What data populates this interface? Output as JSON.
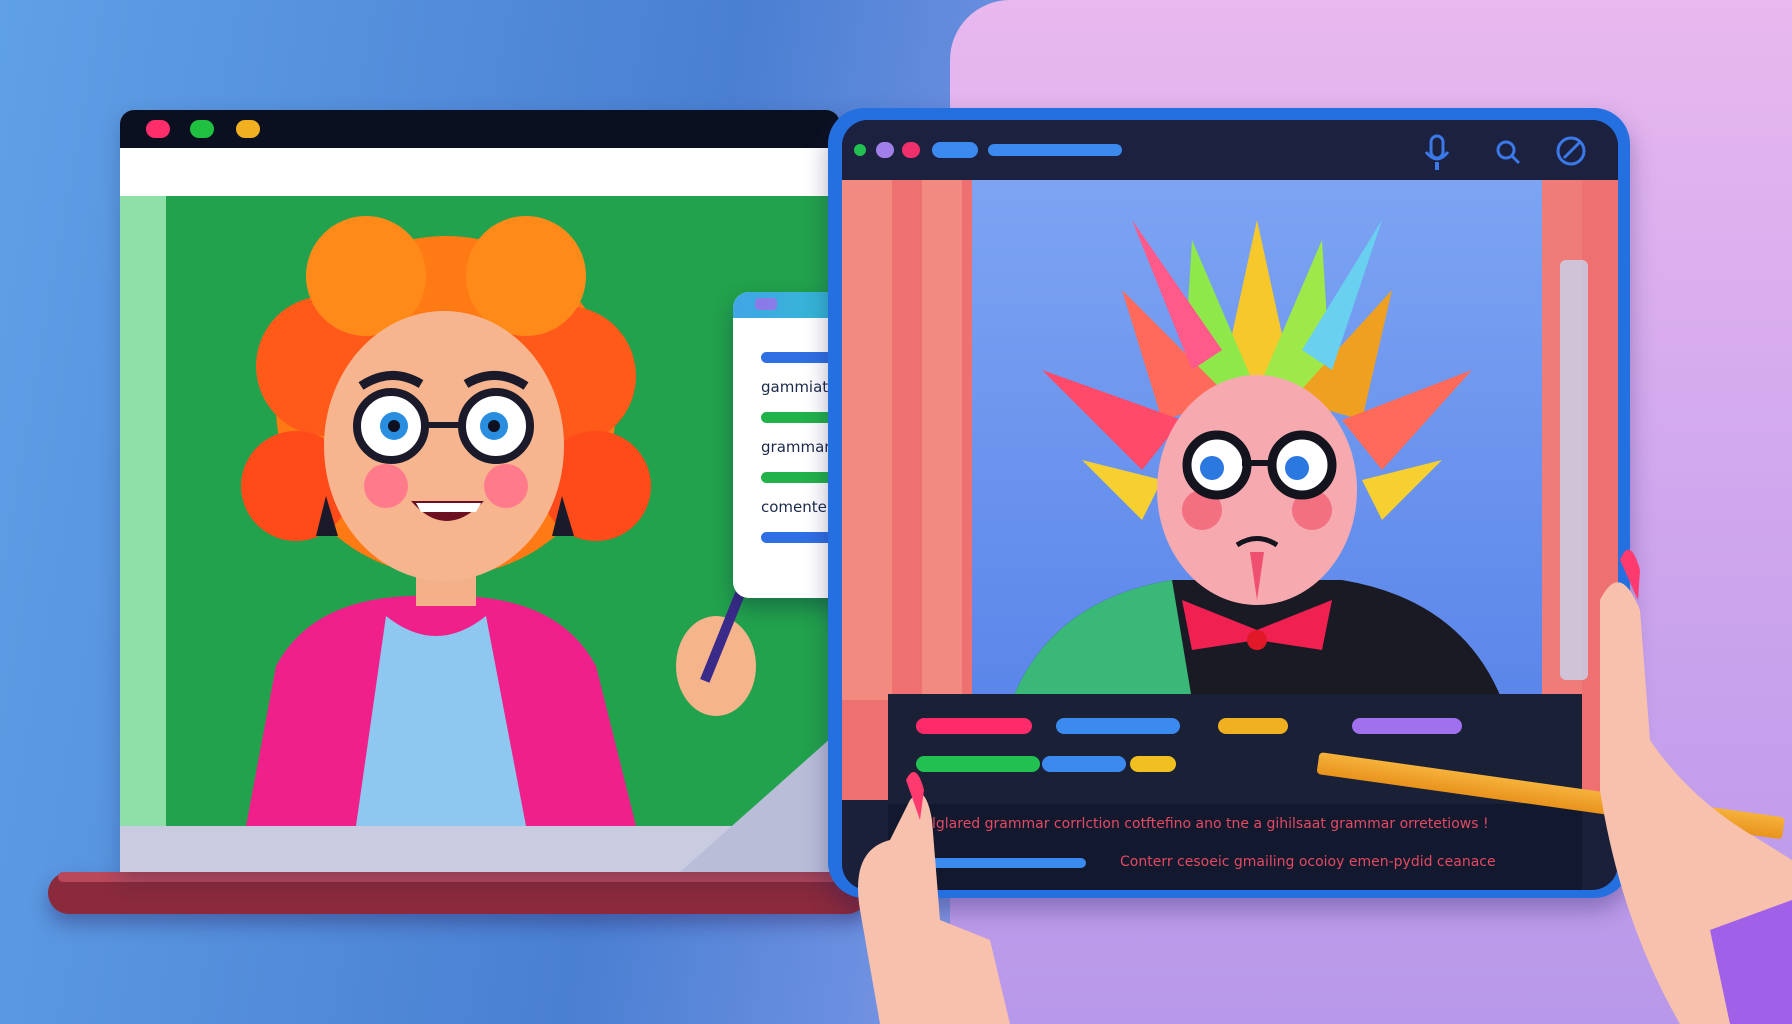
{
  "note_card": {
    "line1": "gammiaters",
    "line2": "grammar corcelent",
    "line3": "comenter"
  },
  "tablet_panel": {
    "line1": "lglared grammar corrlction cotftefino ano tne a gihilsaat grammar orretetiows !",
    "line2": "Conterr cesoeic gmailing ocoioy emen-pydid ceanace"
  },
  "colors": {
    "laptop_screen": "#22a24c",
    "tablet_frame": "#2470e0",
    "accent_pink": "#e8457a",
    "accent_blue": "#2f6fe4",
    "accent_green": "#22b24a"
  },
  "icons": [
    "microphone-icon",
    "search-icon",
    "pen-icon"
  ]
}
